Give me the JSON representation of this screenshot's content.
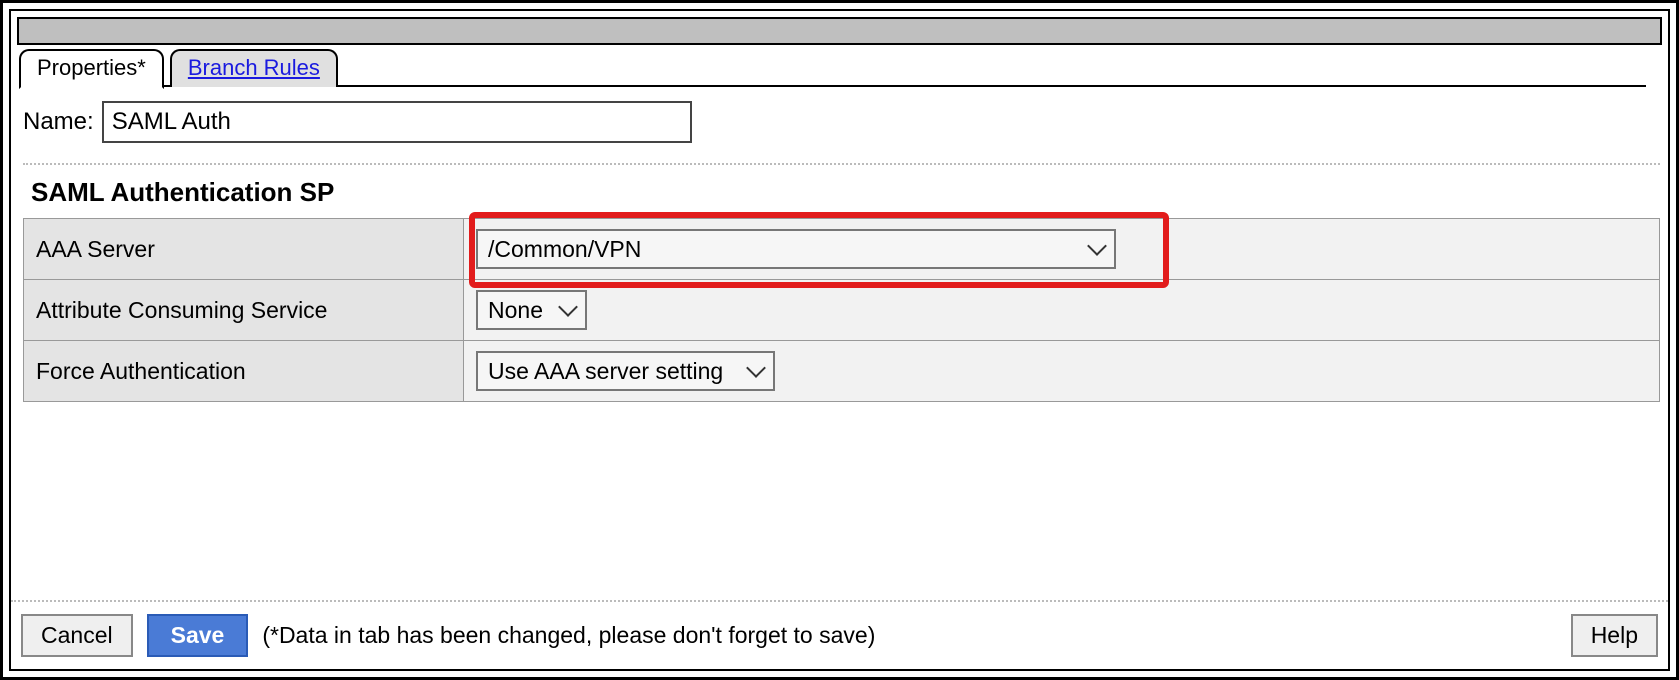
{
  "tabs": {
    "properties": "Properties*",
    "branch_rules": "Branch Rules"
  },
  "form": {
    "name_label": "Name:",
    "name_value": "SAML Auth",
    "section_title": "SAML Authentication SP",
    "rows": {
      "aaa_server": {
        "label": "AAA Server",
        "value": "/Common/VPN"
      },
      "attr_consuming": {
        "label": "Attribute Consuming Service",
        "value": "None"
      },
      "force_auth": {
        "label": "Force Authentication",
        "value": "Use AAA server setting"
      }
    }
  },
  "footer": {
    "cancel": "Cancel",
    "save": "Save",
    "note": "(*Data in tab has been changed, please don't forget to save)",
    "help": "Help"
  }
}
